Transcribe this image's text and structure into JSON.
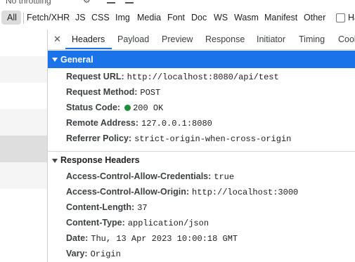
{
  "toolbar": {
    "throttle": "No throttling"
  },
  "filters": [
    "All",
    "Fetch/XHR",
    "JS",
    "CSS",
    "Img",
    "Media",
    "Font",
    "Doc",
    "WS",
    "Wasm",
    "Manifest",
    "Other"
  ],
  "filter_trailing": "Ha",
  "tabs": [
    "Headers",
    "Payload",
    "Preview",
    "Response",
    "Initiator",
    "Timing",
    "Cook"
  ],
  "general": {
    "title": "General",
    "rows": [
      {
        "key": "Request URL:",
        "value": "http://localhost:8080/api/test"
      },
      {
        "key": "Request Method:",
        "value": "POST"
      },
      {
        "key": "Status Code:",
        "value": "200 OK"
      },
      {
        "key": "Remote Address:",
        "value": "127.0.0.1:8080"
      },
      {
        "key": "Referrer Policy:",
        "value": "strict-origin-when-cross-origin"
      }
    ]
  },
  "response_headers": {
    "title": "Response Headers",
    "rows": [
      {
        "key": "Access-Control-Allow-Credentials:",
        "value": "true"
      },
      {
        "key": "Access-Control-Allow-Origin:",
        "value": "http://localhost:3000"
      },
      {
        "key": "Content-Length:",
        "value": "37"
      },
      {
        "key": "Content-Type:",
        "value": "application/json"
      },
      {
        "key": "Date:",
        "value": "Thu, 13 Apr 2023 10:00:18 GMT"
      },
      {
        "key": "Vary:",
        "value": "Origin"
      }
    ]
  },
  "colors": {
    "accent": "#1a73e8",
    "status_ok": "#1e8e3e"
  }
}
